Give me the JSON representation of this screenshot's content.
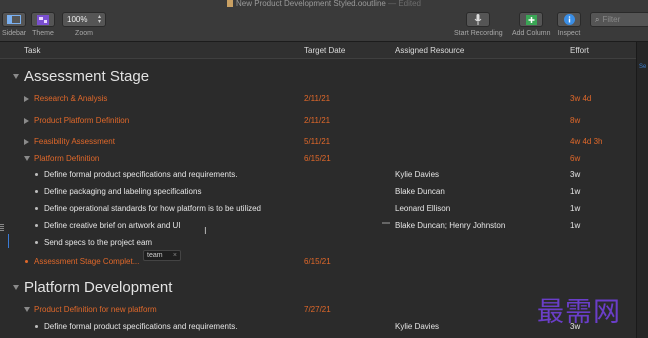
{
  "window": {
    "title": "New Product Development Styled.ooutline",
    "edited": "— Edited"
  },
  "toolbar": {
    "sidebar_label": "Sidebar",
    "theme_label": "Theme",
    "zoom_value": "100%",
    "zoom_label": "Zoom",
    "start_recording_label": "Start Recording",
    "add_column_label": "Add Column",
    "inspect_label": "Inspect",
    "filter_placeholder": "Filter"
  },
  "columns": {
    "task": "Task",
    "target_date": "Target Date",
    "assigned_resource": "Assigned Resource",
    "effort": "Effort"
  },
  "sidebar_right": {
    "tag": "Se"
  },
  "rows": [
    {
      "kind": "section",
      "task": "Assessment Stage",
      "date": "",
      "resource": "",
      "effort": ""
    },
    {
      "kind": "group",
      "task": "Research & Analysis",
      "date": "2/11/21",
      "resource": "",
      "effort": "3w 4d"
    },
    {
      "kind": "group",
      "task": "Product Platform Definition",
      "date": "2/11/21",
      "resource": "",
      "effort": "8w"
    },
    {
      "kind": "group",
      "task": "Feasibility Assessment",
      "date": "5/11/21",
      "resource": "",
      "effort": "4w 4d 3h"
    },
    {
      "kind": "group-open",
      "task": "Platform Definition",
      "date": "6/15/21",
      "resource": "",
      "effort": "6w"
    },
    {
      "kind": "item",
      "task": "Define formal product specifications and requirements.",
      "date": "",
      "resource": "Kylie Davies",
      "effort": "3w"
    },
    {
      "kind": "item",
      "task": "Define packaging and labeling specifications",
      "date": "",
      "resource": "Blake Duncan",
      "effort": "1w"
    },
    {
      "kind": "item",
      "task": "Define operational standards for how platform is to be utilized",
      "date": "",
      "resource": "Leonard Ellison",
      "effort": "1w"
    },
    {
      "kind": "item",
      "task": "Define creative brief on artwork and UI",
      "date": "",
      "resource": "Blake Duncan; Henry Johnston",
      "effort": "1w"
    },
    {
      "kind": "item",
      "task": "Send specs to the project eam",
      "date": "",
      "resource": "",
      "effort": ""
    },
    {
      "kind": "milestone",
      "task": "Assessment Stage Complet...",
      "date": "6/15/21",
      "resource": "",
      "effort": ""
    },
    {
      "kind": "section",
      "task": "Platform Development",
      "date": "",
      "resource": "",
      "effort": ""
    },
    {
      "kind": "group-open",
      "task": "Product Definition for new platform",
      "date": "7/27/21",
      "resource": "",
      "effort": ""
    },
    {
      "kind": "item",
      "task": "Define formal product specifications and requirements.",
      "date": "",
      "resource": "Kylie Davies",
      "effort": "3w"
    }
  ],
  "autocomplete": {
    "suggestion": "team",
    "close": "×"
  },
  "watermark": "最需网",
  "colors": {
    "accent_orange": "#e0682a",
    "background": "#2b2b2b",
    "watermark": "#6a3ec8"
  }
}
